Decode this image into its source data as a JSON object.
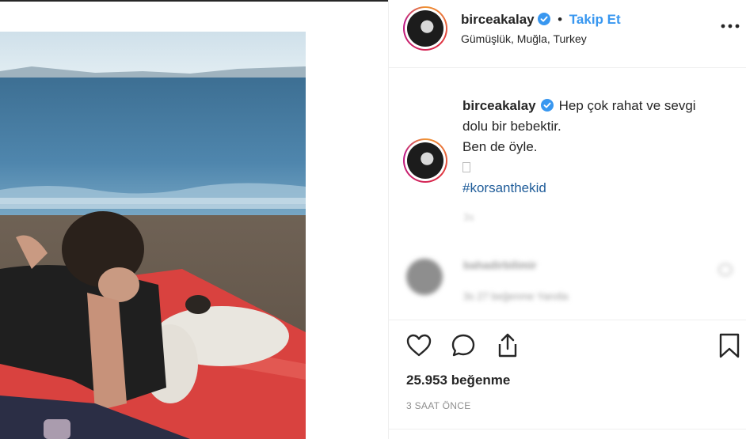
{
  "post": {
    "username": "birceakalay",
    "follow_label": "Takip Et",
    "dot": "•",
    "location": "Gümüşlük, Muğla, Turkey",
    "caption_lines": [
      "Hep çok rahat ve sevgi",
      "dolu bir bebektir.",
      "Ben de öyle."
    ],
    "hashtag": "#korsanthekid",
    "caption_time": "3s",
    "likes": "25.953 beğenme",
    "time_ago": "3 SAAT ÖNCE"
  },
  "comment": {
    "username": "bahadirbilimir",
    "meta": "3s   27 beğenme   Yanıtla"
  },
  "colors": {
    "accent": "#3897f0",
    "verified": "#3897f0",
    "text": "#262626",
    "muted": "#8e8e8e"
  },
  "icons": [
    "more-icon",
    "verified-badge-icon",
    "heart-icon",
    "comment-icon",
    "share-icon",
    "bookmark-icon"
  ]
}
